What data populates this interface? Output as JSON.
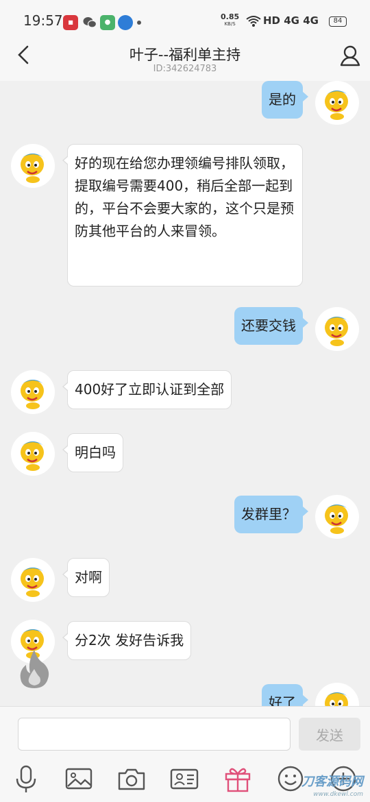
{
  "status_bar": {
    "time": "19:57",
    "net_speed": "0.85",
    "net_unit": "KB/S",
    "signal_text": "HD 4G 4G",
    "battery": "84"
  },
  "header": {
    "title": "叶子--福利单主持",
    "subtitle": "ID:342624783"
  },
  "messages": [
    {
      "side": "out",
      "text": "是的"
    },
    {
      "side": "in",
      "text": "好的现在给您办理领编号排队领取，提取编号需要400，稍后全部一起到的，平台不会要大家的，这个只是预防其他平台的人来冒领。"
    },
    {
      "side": "out",
      "text": "还要交钱"
    },
    {
      "side": "in",
      "text": "400好了立即认证到全部"
    },
    {
      "side": "in",
      "text": "明白吗"
    },
    {
      "side": "out",
      "text": "发群里？"
    },
    {
      "side": "in",
      "text": "对啊"
    },
    {
      "side": "in",
      "text": "分2次 发好告诉我"
    },
    {
      "side": "out",
      "text": "好了"
    }
  ],
  "input": {
    "value": "",
    "send_label": "发送"
  },
  "toolbar": [
    "mic-icon",
    "image-icon",
    "camera-icon",
    "contact-card-icon",
    "gift-icon",
    "emoji-icon",
    "plus-icon"
  ],
  "colors": {
    "outgoing_bubble": "#9fd1f5",
    "incoming_bubble": "#ffffff",
    "gift_accent": "#e0507a"
  },
  "watermark": {
    "line1": "刀客源码网",
    "line2": "www.dkewl.com"
  }
}
